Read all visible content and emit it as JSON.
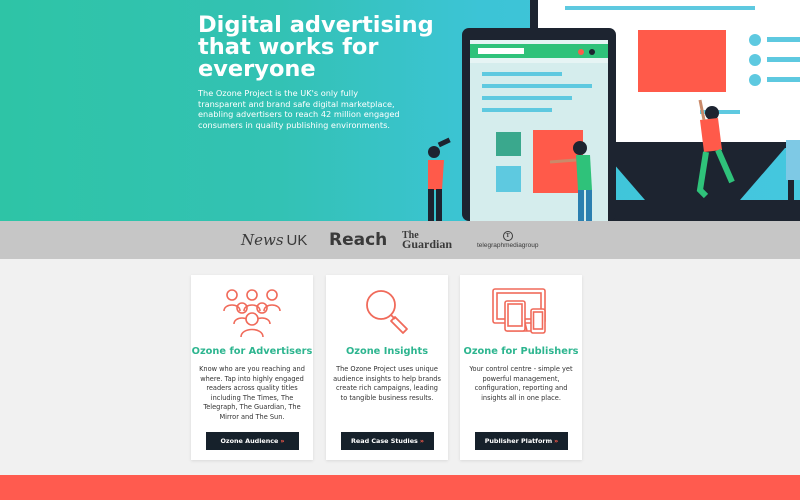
{
  "hero": {
    "title": "Digital advertising that works for everyone",
    "text": "The Ozone Project is the UK's only fully transparent and brand safe digital marketplace, enabling advertisers to reach 42 million engaged consumers in quality publishing environments."
  },
  "partners": {
    "news_uk": {
      "part1": "News",
      "part2": "UK"
    },
    "reach": "Reach",
    "guardian": {
      "line1": "The",
      "line2": "Guardian"
    },
    "telegraph": {
      "mark": "T",
      "label": "telegraphmediagroup"
    }
  },
  "cards": [
    {
      "icon": "people-group-icon",
      "title": "Ozone for Advertisers",
      "text": "Know who are you reaching and where. Tap into highly engaged readers across quality titles including The Times, The Telegraph, The Guardian, The Mirror and The Sun.",
      "button": "Ozone Audience",
      "arrow": "»"
    },
    {
      "icon": "magnifier-icon",
      "title": "Ozone Insights",
      "text": "The Ozone Project uses unique audience insights to help brands create rich campaigns, leading to tangible business results.",
      "button": "Read Case Studies",
      "arrow": "»"
    },
    {
      "icon": "devices-icon",
      "title": "Ozone for Publishers",
      "text": "Your control centre - simple yet powerful management, configuration, reporting and insights all in one place.",
      "button": "Publisher Platform",
      "arrow": "»"
    }
  ],
  "colors": {
    "hero_teal": "#2ec4a6",
    "accent_green": "#2db58f",
    "accent_coral": "#ff5b4f",
    "button_dark": "#16212b",
    "partner_strip": "#c6c6c6"
  }
}
